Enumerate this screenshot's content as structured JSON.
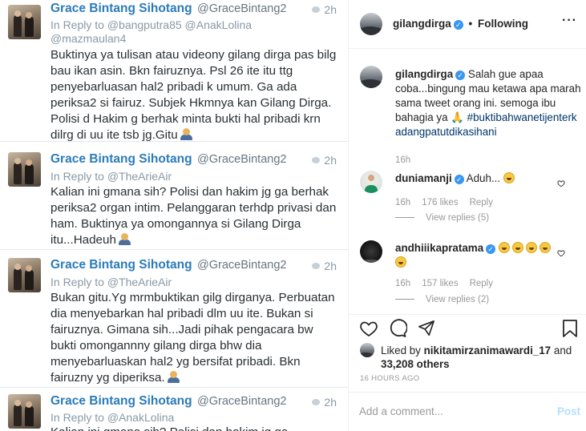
{
  "tweets": [
    {
      "name": "Grace Bintang Sihotang",
      "handle": "@GraceBintang2",
      "time": "2h",
      "reply_prefix": "In Reply to",
      "reply_to": "@bangputra85 @AnakLolina",
      "reply_to_2": "@mazmaulan4",
      "body": "Buktinya ya tulisan atau videony gilang dirga pas bilg bau ikan asin. Bkn fairuznya. Psl 26 ite itu ttg penyebarluasan hal2 pribadi k umum. Ga ada periksa2 si fairuz. Subjek Hkmnya kan Gilang Dirga. Polisi d Hakim g berhak minta bukti hal pribadi krn dilrg di uu ite tsb jg.Gitu"
    },
    {
      "name": "Grace Bintang Sihotang",
      "handle": "@GraceBintang2",
      "time": "2h",
      "reply_prefix": "In Reply to",
      "reply_to": "@TheArieAir",
      "body": "Kalian ini gmana sih? Polisi dan hakim jg ga berhak periksa2 organ intim. Pelanggaran terhdp privasi dan ham. Buktinya ya omongannya si Gilang Dirga itu...Hadeuh"
    },
    {
      "name": "Grace Bintang Sihotang",
      "handle": "@GraceBintang2",
      "time": "2h",
      "reply_prefix": "In Reply to",
      "reply_to": "@TheArieAir",
      "body": "Bukan gitu.Yg mrmbuktikan gilg dirganya. Perbuatan dia menyebarkan hal pribadi dlm uu ite. Bukan si fairuznya. Gimana sih...Jadi pihak pengacara bw bukti omongannny gilang dirga bhw dia menyebarluaskan hal2 yg bersifat pribadi. Bkn fairuzny yg diperiksa."
    },
    {
      "name": "Grace Bintang Sihotang",
      "handle": "@GraceBintang2",
      "time": "2h",
      "reply_prefix": "In Reply to",
      "reply_to": "@AnakLolina",
      "body": "Kalian ini gmana sih? Polisi dan hakim jg ga"
    }
  ],
  "ig": {
    "header": {
      "username": "gilangdirga",
      "follow_state": "Following",
      "more": "···"
    },
    "caption": {
      "username": "gilangdirga",
      "text": "Salah gue apaa coba...bingung mau ketawa apa marah sama tweet orang ini. semoga ibu bahagia ya 🙏",
      "hashtag": "#buktibahwanetijenterkadangpatutdikasihani",
      "time": "16h"
    },
    "comments": [
      {
        "username": "duniamanji",
        "text": "Aduh...",
        "time": "16h",
        "likes": "176 likes",
        "reply": "Reply",
        "view_replies": "View replies (5)"
      },
      {
        "username": "andhiiikapratama",
        "text": "",
        "time": "16h",
        "likes": "157 likes",
        "reply": "Reply",
        "view_replies": "View replies (2)"
      }
    ],
    "liked_by_prefix": "Liked by",
    "liked_by_user": "nikitamirzanimawardi_17",
    "liked_by_and": "and",
    "liked_by_others": "33,208 others",
    "post_age": "16 HOURS AGO",
    "comment_placeholder": "Add a comment...",
    "post_button": "Post"
  },
  "colors": {
    "twitter_name": "#2b7bb9",
    "ig_link": "#003569",
    "verified": "#3897f0"
  }
}
